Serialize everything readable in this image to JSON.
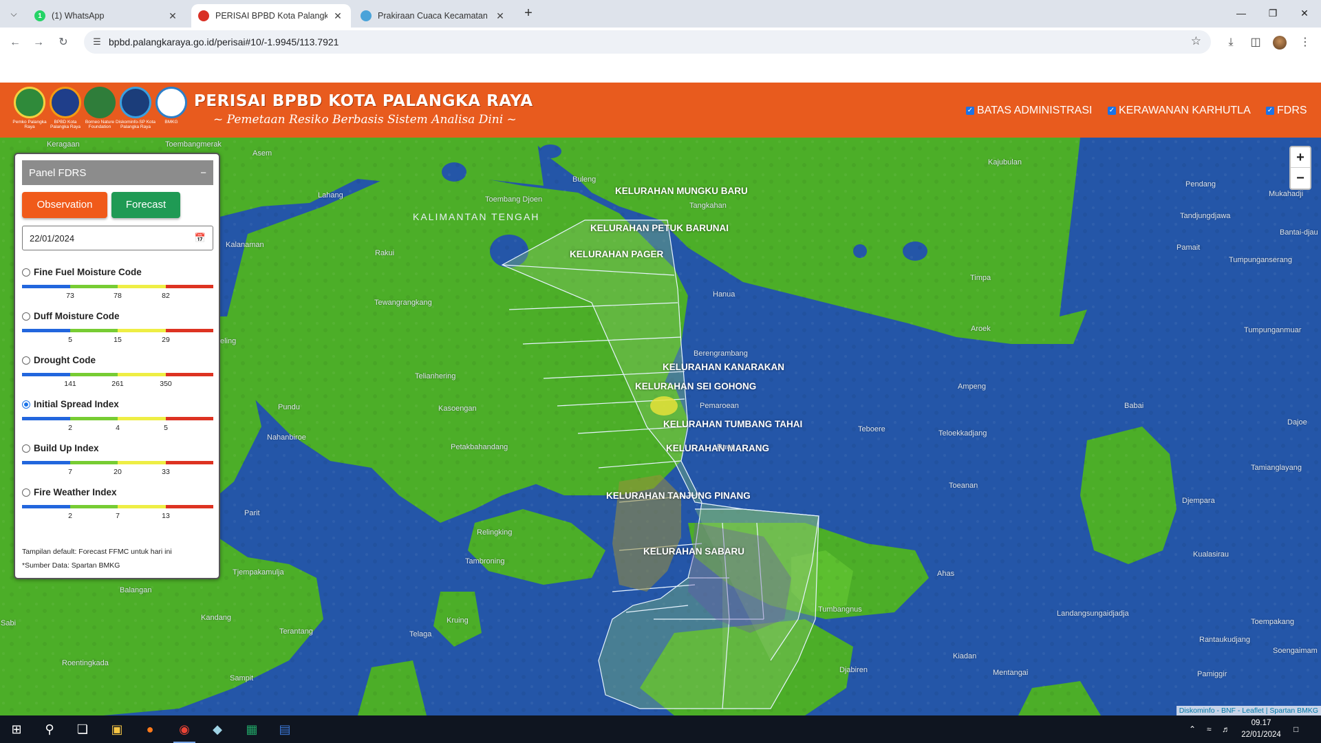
{
  "browser": {
    "tabs": [
      {
        "title": "(1) WhatsApp",
        "favicon": "whatsapp-icon",
        "badge": "1",
        "color": "#25d366"
      },
      {
        "title": "PERISAI BPBD Kota Palangka Ra",
        "favicon": "bpbd-icon",
        "color": "#d93025"
      },
      {
        "title": "Prakiraan Cuaca Kecamatan Pal",
        "favicon": "bmkg-icon",
        "color": "#4aa3d9"
      }
    ],
    "url": "bpbd.palangkaraya.go.id/perisai#10/-1.9945/113.7921"
  },
  "site": {
    "title": "PERISAI BPBD KOTA PALANGKA RAYA",
    "subtitle": "~ Pemetaan Resiko Berbasis Sistem Analisa Dini ~",
    "logos": [
      {
        "caption": "Pemko Palangka Raya",
        "color": "#2f8a3a"
      },
      {
        "caption": "BPBD Kota Palangka Raya",
        "color": "#1f3e8a"
      },
      {
        "caption": "Borneo Nature Foundation",
        "color": "#2f7d3a"
      },
      {
        "caption": "Diskominfo-SP Kota Palangka Raya",
        "color": "#1b3d7a"
      },
      {
        "caption": "BMKG",
        "color": "#2c7fc9"
      }
    ],
    "layers": [
      {
        "label": "BATAS ADMINISTRASI",
        "checked": true
      },
      {
        "label": "KERAWANAN KARHUTLA",
        "checked": true
      },
      {
        "label": "FDRS",
        "checked": true
      }
    ]
  },
  "panel": {
    "title": "Panel FDRS",
    "collapse": "−",
    "observation": "Observation",
    "forecast": "Forecast",
    "date": "22/01/2024",
    "indices": [
      {
        "label": "Fine Fuel Moisture Code",
        "ticks": [
          "73",
          "78",
          "82"
        ],
        "selected": false
      },
      {
        "label": "Duff Moisture Code",
        "ticks": [
          "5",
          "15",
          "29"
        ],
        "selected": false
      },
      {
        "label": "Drought Code",
        "ticks": [
          "141",
          "261",
          "350"
        ],
        "selected": false
      },
      {
        "label": "Initial Spread Index",
        "ticks": [
          "2",
          "4",
          "5"
        ],
        "selected": true
      },
      {
        "label": "Build Up Index",
        "ticks": [
          "7",
          "20",
          "33"
        ],
        "selected": false
      },
      {
        "label": "Fire Weather Index",
        "ticks": [
          "2",
          "7",
          "13"
        ],
        "selected": false
      }
    ],
    "scale_colors": [
      "#2266dd",
      "#77cc33",
      "#eeee44",
      "#dd3322"
    ],
    "note1": "Tampilan default: Forecast FFMC untuk hari ini",
    "note2": "*Sumber Data: Spartan BMKG"
  },
  "map": {
    "zoom_in": "+",
    "zoom_out": "−",
    "attribution": "Diskominfo - BNF - Leaflet | Spartan BMKG",
    "region": "KALIMANTAN TENGAH",
    "places": [
      "Keragaan",
      "Toembangmerak",
      "Asem",
      "Buleng",
      "Kajubulan",
      "Pendang",
      "Mukahadji",
      "Tandjungdjawa",
      "Bantai-djau",
      "Lahang",
      "Toembang Djoen",
      "Tangkahan",
      "Kalanaman",
      "Rakui",
      "Pamait",
      "Tumpunganserang",
      "Hanua",
      "Timpa",
      "Tewangrangkang",
      "Aroek",
      "Tumpunganmuar",
      "Berengrambang",
      "Ampeng",
      "Telianhering",
      "Babai",
      "Pundu",
      "Kasoengan",
      "Pemaroean",
      "Teboere",
      "Teloekkadjang",
      "Dajoe",
      "Nahanbiroe",
      "Petakbahandang",
      "Rawi",
      "Tamianglayang",
      "Toeanan",
      "Parit",
      "Djempara",
      "Relingking",
      "Tambroning",
      "Ahas",
      "Kualasirau",
      "Tjempakamulja",
      "Balangan",
      "Kruing",
      "Tumbangnus",
      "Landangsungaidjadja",
      "Sabi",
      "Kandang",
      "Toempakang",
      "Terantang",
      "Telaga",
      "Rantaukudjang",
      "Kiadan",
      "Roentingkada",
      "Soengaimam",
      "Djabiren",
      "Mentangai",
      "Pamiggir",
      "Sampit",
      "eling"
    ],
    "kelurahan": [
      "KELURAHAN MUNGKU BARU",
      "KELURAHAN PETUK BARUNAI",
      "KELURAHAN PAGER",
      "KELURAHAN KANARAKAN",
      "KELURAHAN SEI GOHONG",
      "KELURAHAN TUMBANG TAHAI",
      "KELURAHAN MARANG",
      "KELURAHAN TANJUNG PINANG",
      "KELURAHAN SABARU"
    ]
  },
  "taskbar": {
    "time": "09.17",
    "date": "22/01/2024"
  }
}
